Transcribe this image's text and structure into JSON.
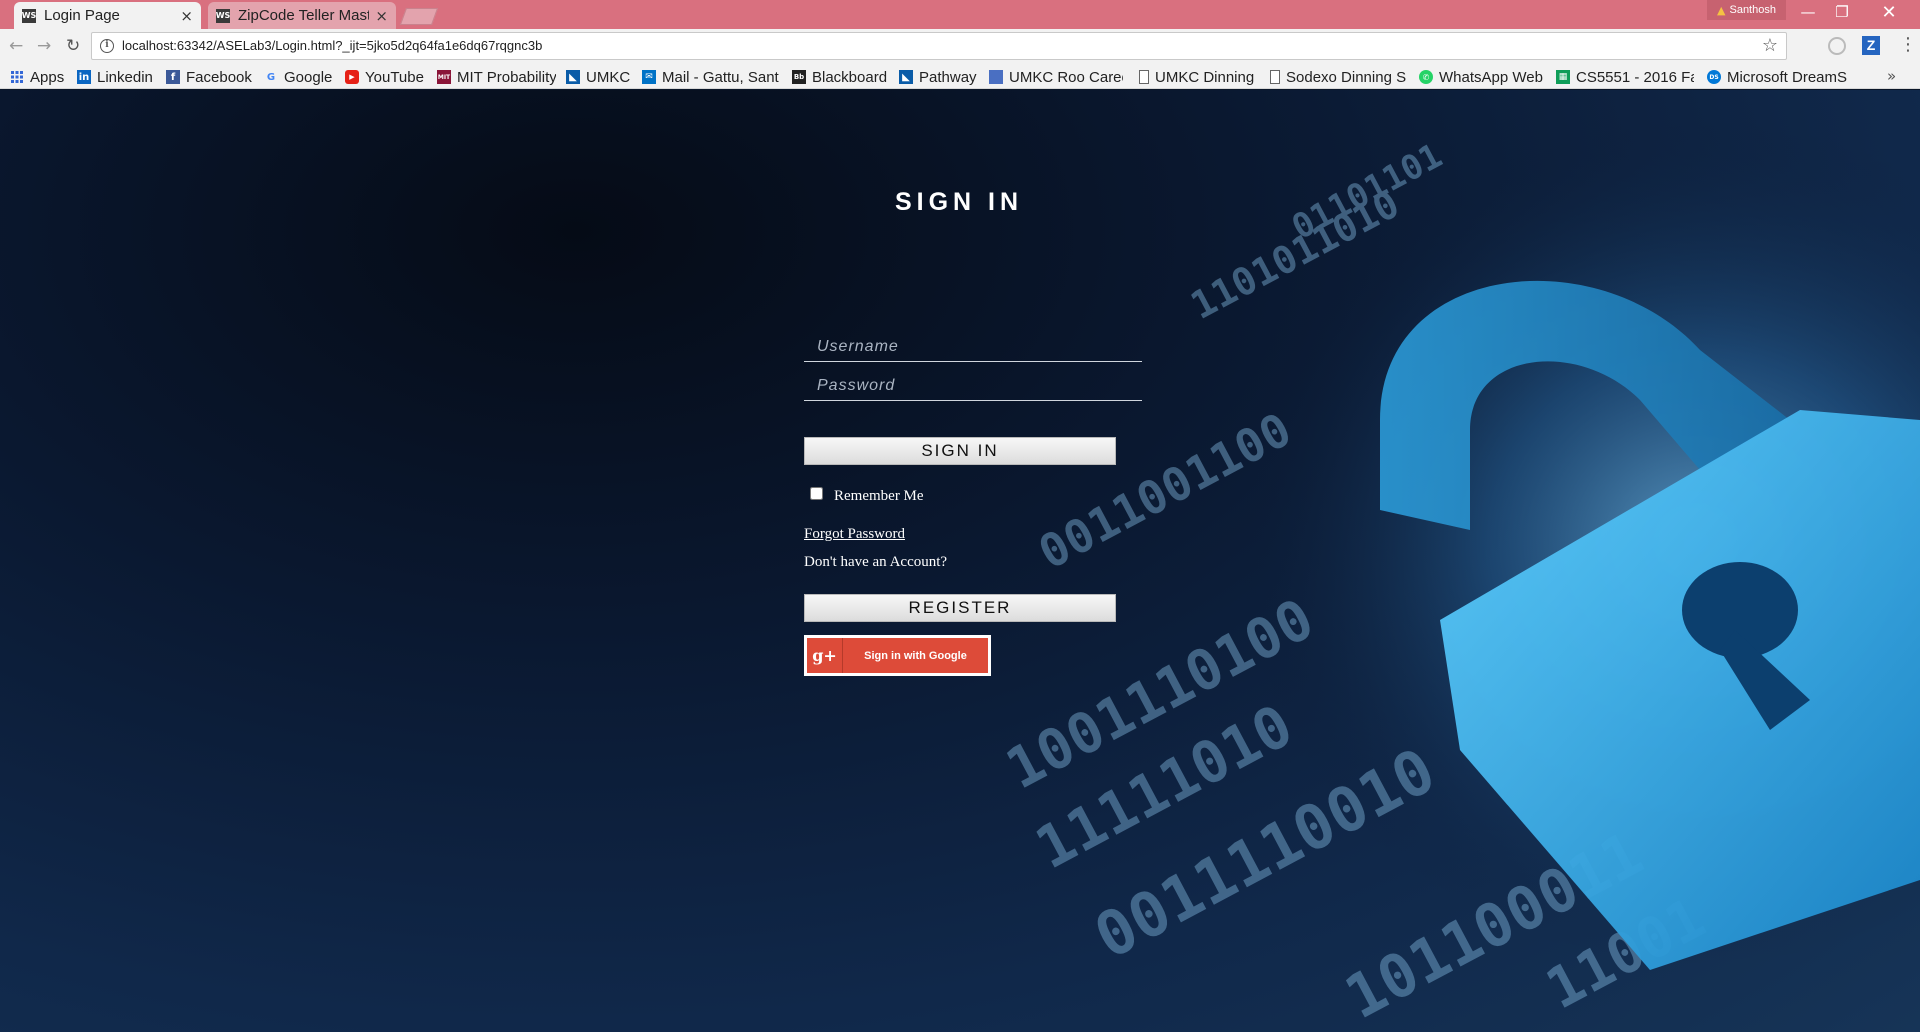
{
  "browser": {
    "tabs": [
      {
        "title": "Login Page",
        "favicon": "WS"
      },
      {
        "title": "ZipCode Teller Mast",
        "favicon": "WS"
      }
    ],
    "profile_name": "Santhosh",
    "url": "localhost:63342/ASELab3/Login.html?_ijt=5jko5d2q64fa1e6dq67rqgnc3b",
    "bookmarks": [
      {
        "label": "Apps",
        "icon": "apps-grid-icon",
        "color": "#3367d6"
      },
      {
        "label": "Linkedin",
        "icon": "linkedin-icon",
        "color": "#0a66c2"
      },
      {
        "label": "Facebook",
        "icon": "facebook-icon",
        "color": "#3b5998"
      },
      {
        "label": "Google",
        "icon": "google-icon",
        "color": "#4285f4"
      },
      {
        "label": "YouTube",
        "icon": "youtube-icon",
        "color": "#e62117"
      },
      {
        "label": "MIT Probability",
        "icon": "mit-icon",
        "color": "#8a1538"
      },
      {
        "label": "UMKC",
        "icon": "umkc-icon",
        "color": "#0a5ca8"
      },
      {
        "label": "Mail - Gattu, Sant",
        "icon": "mail-icon",
        "color": "#0072c6"
      },
      {
        "label": "Blackboard",
        "icon": "blackboard-icon",
        "color": "#222222"
      },
      {
        "label": "Pathway",
        "icon": "pathway-icon",
        "color": "#0a5ca8"
      },
      {
        "label": "UMKC Roo Caree",
        "icon": "umkc-career-icon",
        "color": "#4a6fc2"
      },
      {
        "label": "UMKC Dinning",
        "icon": "page-icon",
        "color": "#ffffff"
      },
      {
        "label": "Sodexo Dinning S",
        "icon": "page-icon",
        "color": "#ffffff"
      },
      {
        "label": "WhatsApp Web",
        "icon": "whatsapp-icon",
        "color": "#25d366"
      },
      {
        "label": "CS5551 - 2016 Fa",
        "icon": "sheets-icon",
        "color": "#0f9d58"
      },
      {
        "label": "Microsoft DreamS",
        "icon": "dreamspark-icon",
        "color": "#0078d7"
      }
    ]
  },
  "login": {
    "title": "SIGN IN",
    "username_placeholder": "Username",
    "password_placeholder": "Password",
    "signin_button": "SIGN IN",
    "remember_me": "Remember Me",
    "forgot_password": "Forgot Password",
    "no_account": "Don't have an Account?",
    "register_button": "REGISTER",
    "google_button": "Sign in with Google",
    "google_icon_text": "g+"
  },
  "colors": {
    "titlebar": "#d9707f",
    "google_red": "#dd4b39",
    "lock_blue": "#29a9e6"
  }
}
